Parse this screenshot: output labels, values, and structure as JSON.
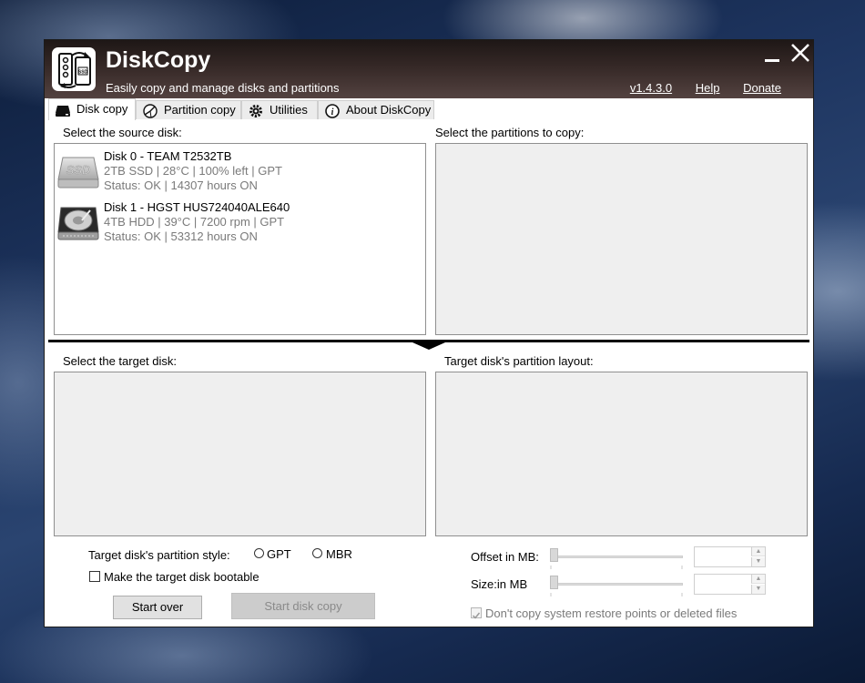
{
  "app": {
    "title": "DiskCopy",
    "subtitle": "Easily copy and manage disks and partitions",
    "version": "v1.4.3.0",
    "help": "Help",
    "donate": "Donate",
    "icon_text": "SSD"
  },
  "tabs": [
    {
      "label": "Disk copy",
      "icon": "disk-icon",
      "active": true
    },
    {
      "label": "Partition copy",
      "icon": "partition-icon",
      "active": false
    },
    {
      "label": "Utilities",
      "icon": "gear-icon",
      "active": false
    },
    {
      "label": "About DiskCopy",
      "icon": "info-icon",
      "active": false
    }
  ],
  "source": {
    "label": "Select the source disk:",
    "disks": [
      {
        "name": "Disk 0 - TEAM T2532TB",
        "info": "2TB SSD | 28°C | 100% left | GPT",
        "status": "Status: OK | 14307 hours ON",
        "icon": "ssd-icon",
        "icon_text": "SSD"
      },
      {
        "name": "Disk 1 - HGST HUS724040ALE640",
        "info": "4TB HDD | 39°C | 7200 rpm | GPT",
        "status": "Status: OK | 53312 hours ON",
        "icon": "hdd-icon"
      }
    ]
  },
  "partitions_label": "Select the partitions to copy:",
  "target": {
    "label": "Select the target disk:",
    "layout_label": "Target disk's partition layout:"
  },
  "options": {
    "style_label": "Target disk's partition style:",
    "gpt": "GPT",
    "mbr": "MBR",
    "bootable": "Make the target disk bootable",
    "start_over": "Start over",
    "start_copy": "Start disk copy",
    "offset_label": "Offset in MB:",
    "size_label": "Size:in MB",
    "offset_value": "",
    "size_value": "",
    "offset_fraction": 0,
    "size_fraction": 0,
    "dont_copy": "Don't copy system restore points or deleted files"
  },
  "colors": {
    "titlebar_top": "#1e1716",
    "titlebar_bottom": "#534240",
    "panel_bg": "#efefef"
  }
}
